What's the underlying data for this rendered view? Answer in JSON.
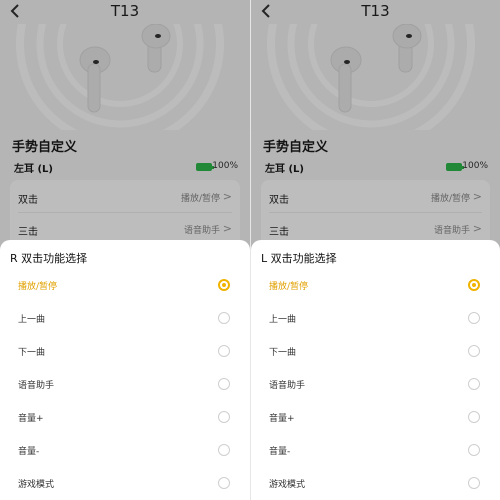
{
  "panels": [
    {
      "header": {
        "title": "T13"
      },
      "section_title": "手势自定义",
      "ear": {
        "label": "左耳 (L)",
        "battery": "100%"
      },
      "settings": [
        {
          "name": "双击",
          "value": "播放/暂停"
        },
        {
          "name": "三击",
          "value": "语音助手"
        }
      ],
      "sheet": {
        "title": "R 双击功能选择",
        "options": [
          "播放/暂停",
          "上一曲",
          "下一曲",
          "语音助手",
          "音量+",
          "音量-",
          "游戏模式"
        ],
        "selected": "播放/暂停"
      }
    },
    {
      "header": {
        "title": "T13"
      },
      "section_title": "手势自定义",
      "ear": {
        "label": "左耳 (L)",
        "battery": "100%"
      },
      "settings": [
        {
          "name": "双击",
          "value": "播放/暂停"
        },
        {
          "name": "三击",
          "value": "语音助手"
        }
      ],
      "sheet": {
        "title": "L 双击功能选择",
        "options": [
          "播放/暂停",
          "上一曲",
          "下一曲",
          "语音助手",
          "音量+",
          "音量-",
          "游戏模式"
        ],
        "selected": "播放/暂停"
      }
    }
  ],
  "colors": {
    "accent": "#f0b400",
    "battery": "#2cb84a"
  },
  "icons": {
    "back": "chevron-left-icon",
    "chevron": "chevron-right-icon"
  }
}
